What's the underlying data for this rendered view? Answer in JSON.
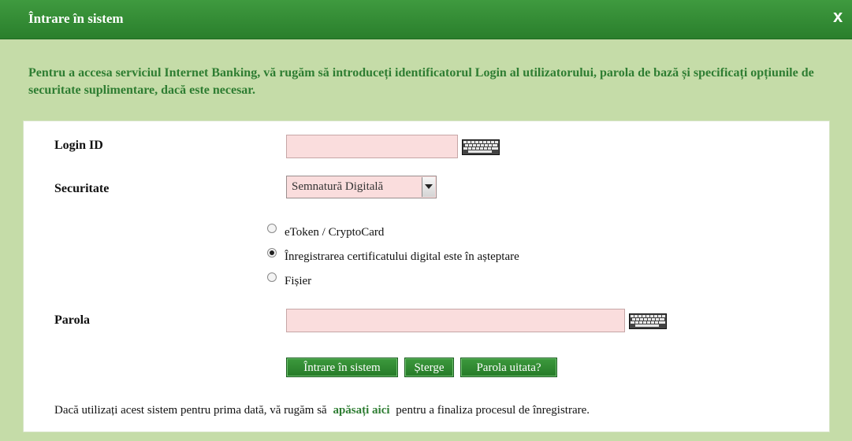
{
  "dialog": {
    "title": "Întrare în sistem",
    "close_label": "x"
  },
  "intro_text": "Pentru a accesa serviciul Internet Banking, vă rugăm să introduceți identificatorul Login al utilizatorului, parola de bază și specificați opțiunile de securitate suplimentare, dacă este necesar.",
  "form": {
    "login_label": "Login ID",
    "login_value": "",
    "security_label": "Securitate",
    "security_selected": "Semnatură Digitală",
    "radio_options": [
      {
        "label": "eToken / CryptoCard",
        "checked": false
      },
      {
        "label": "Înregistrarea certificatului digital este în așteptare",
        "checked": true
      },
      {
        "label": "Fișier",
        "checked": false
      }
    ],
    "password_label": "Parola",
    "password_value": ""
  },
  "buttons": {
    "login": "Întrare în sistem",
    "clear": "Șterge",
    "forgot": "Parola uitata?"
  },
  "footer": {
    "text_before": "Dacă utilizați acest sistem pentru prima dată, vă rugăm să",
    "link": "apăsați aici",
    "text_after": "pentru a finaliza procesul de înregistrare."
  },
  "colors": {
    "title_bar": "#2e8b2f",
    "background": "#c5dca8",
    "accent_text": "#2e7d32",
    "field_background": "#fadddd"
  },
  "icons": [
    "close-icon",
    "keyboard-icon"
  ]
}
